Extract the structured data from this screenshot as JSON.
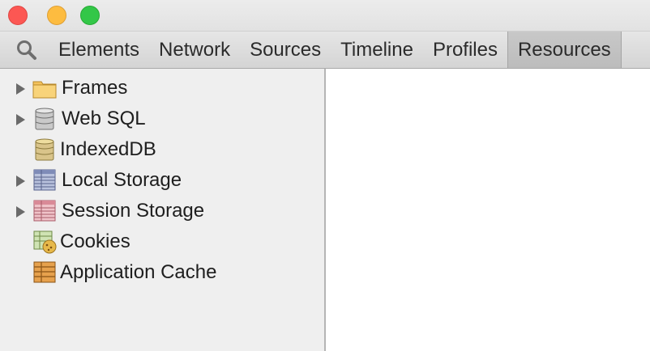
{
  "window": {
    "controls": [
      "close",
      "minimize",
      "maximize"
    ]
  },
  "toolbar": {
    "search_icon": "search-icon",
    "tabs": [
      {
        "label": "Elements"
      },
      {
        "label": "Network"
      },
      {
        "label": "Sources"
      },
      {
        "label": "Timeline"
      },
      {
        "label": "Profiles"
      },
      {
        "label": "Resources",
        "active": true
      }
    ]
  },
  "sidebar": {
    "items": [
      {
        "label": "Frames",
        "icon": "folder-icon",
        "expandable": true
      },
      {
        "label": "Web SQL",
        "icon": "database-icon",
        "expandable": true
      },
      {
        "label": "IndexedDB",
        "icon": "database-gold-icon",
        "expandable": false
      },
      {
        "label": "Local Storage",
        "icon": "table-blue-icon",
        "expandable": true
      },
      {
        "label": "Session Storage",
        "icon": "table-red-icon",
        "expandable": true
      },
      {
        "label": "Cookies",
        "icon": "cookie-icon",
        "expandable": false
      },
      {
        "label": "Application Cache",
        "icon": "table-orange-icon",
        "expandable": false
      }
    ]
  },
  "colors": {
    "close": "#fc5753",
    "minimize": "#fdbc40",
    "maximize": "#33c748",
    "active_tab": "#c4c4c4"
  }
}
